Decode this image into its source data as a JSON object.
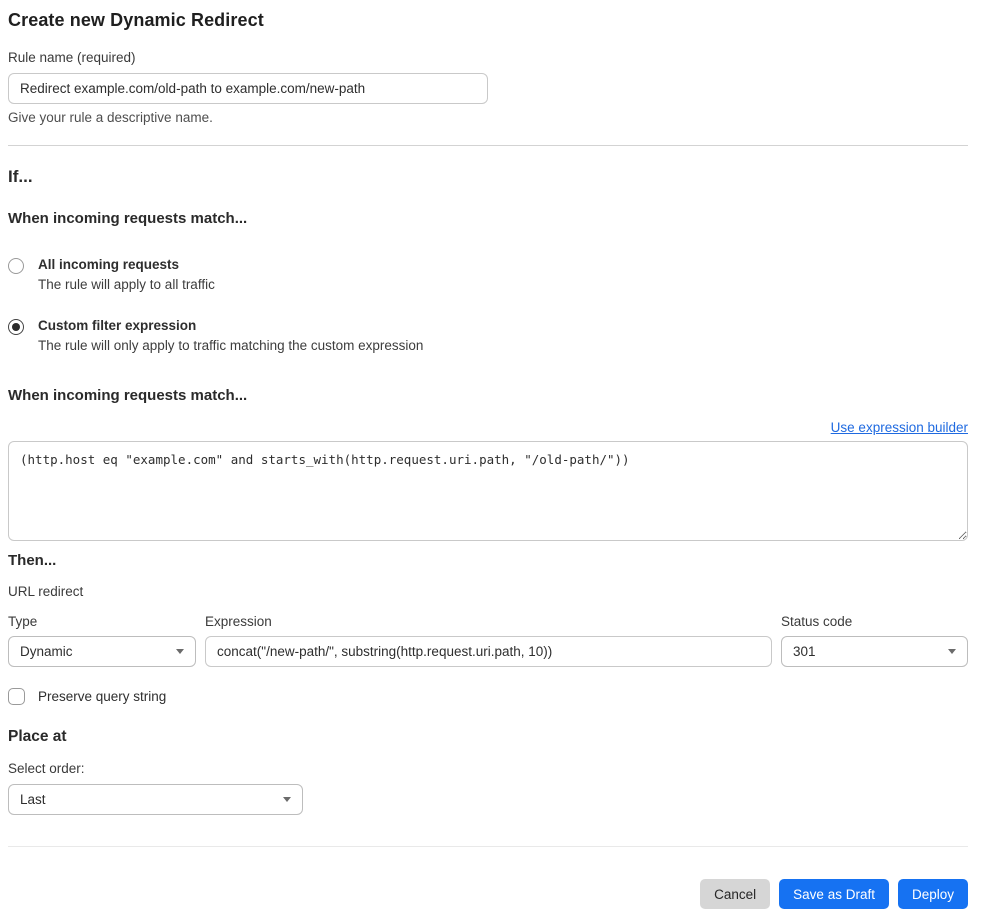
{
  "page": {
    "title": "Create new Dynamic Redirect"
  },
  "rule_name": {
    "label": "Rule name (required)",
    "value": "Redirect example.com/old-path to example.com/new-path",
    "help": "Give your rule a descriptive name."
  },
  "if_section": {
    "heading": "If...",
    "subheading": "When incoming requests match...",
    "options": [
      {
        "label": "All incoming requests",
        "description": "The rule will apply to all traffic",
        "selected": false
      },
      {
        "label": "Custom filter expression",
        "description": "The rule will only apply to traffic matching the custom expression",
        "selected": true
      }
    ]
  },
  "expression_editor": {
    "heading": "When incoming requests match...",
    "builder_link": "Use expression builder",
    "value": "(http.host eq \"example.com\" and starts_with(http.request.uri.path, \"/old-path/\"))"
  },
  "then_section": {
    "heading": "Then...",
    "action_label": "URL redirect",
    "type_field": {
      "label": "Type",
      "value": "Dynamic"
    },
    "expression_field": {
      "label": "Expression",
      "value": "concat(\"/new-path/\", substring(http.request.uri.path, 10))"
    },
    "status_field": {
      "label": "Status code",
      "value": "301"
    },
    "preserve_query_label": "Preserve query string"
  },
  "place_at": {
    "heading": "Place at",
    "label": "Select order:",
    "value": "Last"
  },
  "footer": {
    "cancel_label": "Cancel",
    "save_draft_label": "Save as Draft",
    "deploy_label": "Deploy"
  },
  "colors": {
    "primary_blue": "#1672f2",
    "link_blue": "#1f6ae0",
    "cancel_gray": "#d6d6d6"
  }
}
